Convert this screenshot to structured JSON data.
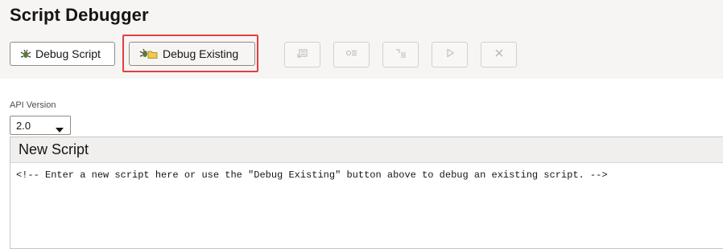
{
  "page": {
    "title": "Script Debugger"
  },
  "toolbar": {
    "debug_script_label": "Debug Script",
    "debug_existing_label": "Debug Existing",
    "tools": [
      {
        "icon": "step-out-icon"
      },
      {
        "icon": "step-over-icon"
      },
      {
        "icon": "step-into-icon"
      },
      {
        "icon": "play-icon"
      },
      {
        "icon": "stop-icon"
      }
    ]
  },
  "api_version": {
    "label": "API Version",
    "selected": "2.0"
  },
  "editor": {
    "tab_title": "New Script",
    "content": "<!-- Enter a new script here or use the \"Debug Existing\" button above to debug an existing script. -->"
  },
  "colors": {
    "highlight": "#e53d3d",
    "header_bg": "#f6f5f4",
    "editor_header_bg": "#f1efed"
  }
}
